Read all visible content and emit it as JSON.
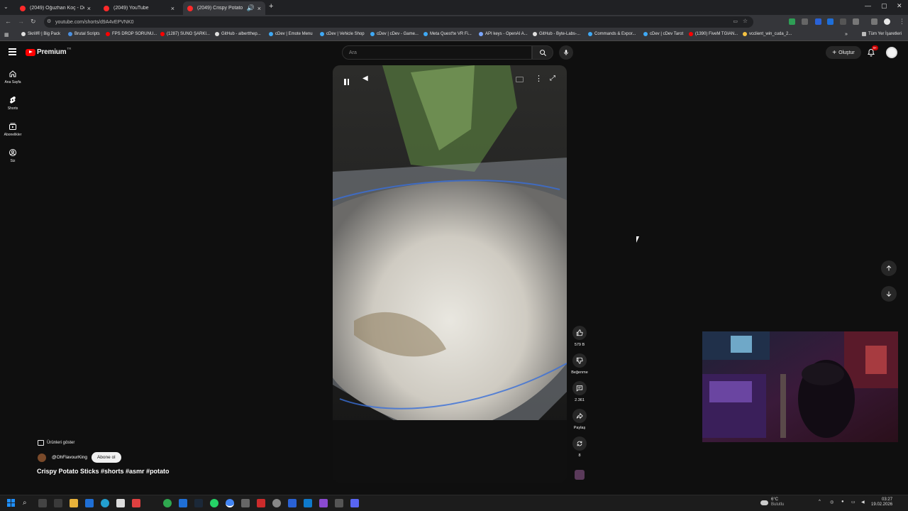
{
  "browser": {
    "tabs": [
      {
        "title": "(2049) Oğuzhan Koç - Domuz G..."
      },
      {
        "title": "(2049) YouTube"
      },
      {
        "title": "(2049) Crispy Potato Sticks"
      }
    ],
    "new_tab_label": "+",
    "url": "youtube.com/shorts/d9A4vEPVNK0",
    "bookmarks": [
      {
        "label": "Skrill® | Big Pack",
        "color": "#e0e0e0"
      },
      {
        "label": "Brutal Scripts",
        "color": "#4a90e2"
      },
      {
        "label": "FPS DROP SORUNU...",
        "color": "#ff0000"
      },
      {
        "label": "(1287) SUNO ŞARKI...",
        "color": "#ff0000"
      },
      {
        "label": "GitHub - albertthep...",
        "color": "#e0e0e0"
      },
      {
        "label": "cDev | Emote Menu",
        "color": "#3fa9f5"
      },
      {
        "label": "cDev | Vehicle Shop",
        "color": "#3fa9f5"
      },
      {
        "label": "cDev | cDev - Game...",
        "color": "#3fa9f5"
      },
      {
        "label": "Meta Quest'te VR Fi...",
        "color": "#3fa9f5"
      },
      {
        "label": "API keys - OpenAI A...",
        "color": "#7aa6ff"
      },
      {
        "label": "GitHub - Byte-Labs-...",
        "color": "#e0e0e0"
      },
      {
        "label": "Commands & Expor...",
        "color": "#3fa9f5"
      },
      {
        "label": "cDev | cDev Tarot",
        "color": "#3fa9f5"
      },
      {
        "label": "(1390) FiveM TGIAN...",
        "color": "#ff0000"
      },
      {
        "label": "vcclient_win_cuda_2...",
        "color": "#f5c242"
      }
    ],
    "all_bookmarks_label": "Tüm Yer İşaretleri"
  },
  "youtube": {
    "logo_text": "Premium",
    "logo_sup": "TR",
    "search_placeholder": "Ara",
    "create_label": "Oluştur",
    "notif_count": "9+",
    "sidebar": [
      {
        "label": "Ana Sayfa",
        "icon": "home-icon"
      },
      {
        "label": "Shorts",
        "icon": "shorts-icon"
      },
      {
        "label": "Abonelikler",
        "icon": "subscriptions-icon"
      },
      {
        "label": "Siz",
        "icon": "you-icon"
      }
    ]
  },
  "short": {
    "title": "Crispy Potato Sticks #shorts #asmr #potato",
    "channel": "@OhFlavourKing",
    "subscribe_label": "Abone ol",
    "products_label": "Ürünleri göster",
    "actions": [
      {
        "label": "579 B",
        "icon": "like-icon"
      },
      {
        "label": "Beğenme",
        "icon": "dislike-icon"
      },
      {
        "label": "2.361",
        "icon": "comment-icon"
      },
      {
        "label": "Paylaş",
        "icon": "share-icon"
      },
      {
        "label": "8",
        "icon": "remix-icon"
      }
    ]
  },
  "taskbar": {
    "weather_temp": "6°C",
    "weather_desc": "Bulutlu",
    "time": "03:27",
    "date": "19.02.2026"
  }
}
